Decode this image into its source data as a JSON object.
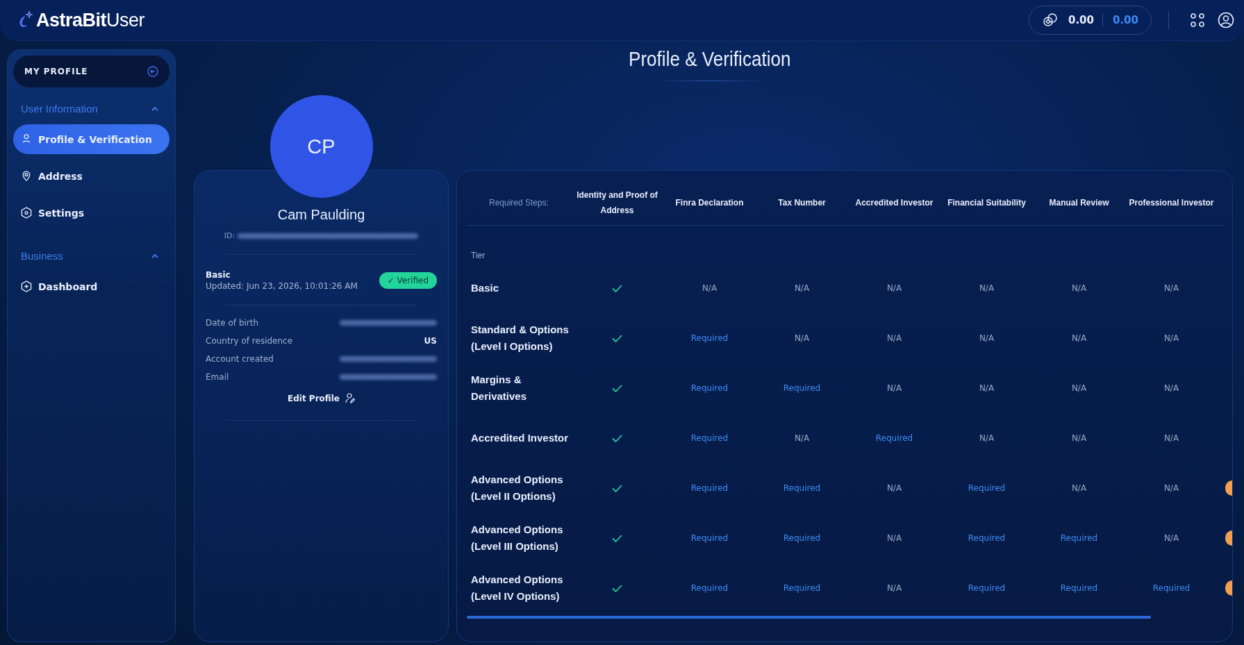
{
  "header": {
    "logo_bold": "AstraBit",
    "logo_light": "User",
    "balance_primary": "0.00",
    "balance_secondary": "0.00"
  },
  "sidebar": {
    "title": "MY PROFILE",
    "sections": [
      {
        "label": "User Information",
        "expanded": true,
        "items": [
          {
            "label": "Profile & Verification",
            "selected": true
          },
          {
            "label": "Address",
            "selected": false
          },
          {
            "label": "Settings",
            "selected": false
          }
        ]
      },
      {
        "label": "Business",
        "expanded": true,
        "items": [
          {
            "label": "Dashboard",
            "selected": false
          }
        ]
      }
    ]
  },
  "page_title": "Profile & Verification",
  "profile": {
    "initials": "CP",
    "name": "Cam Paulding",
    "id_label": "ID:",
    "tier": "Basic",
    "updated": "Updated: Jun 23, 2026, 10:01:26 AM",
    "status": "✓ Verified",
    "verified": true,
    "fields": [
      {
        "label": "Date of birth",
        "redacted": true
      },
      {
        "label": "Country of residence",
        "value": "US",
        "redacted": false
      },
      {
        "label": "Account created",
        "redacted": true
      },
      {
        "label": "Email",
        "redacted": true
      }
    ],
    "edit_button": "Edit Profile"
  },
  "table": {
    "corner": "Required Steps:",
    "columns": [
      "Identity and Proof of Address",
      "Finra Declaration",
      "Tax Number",
      "Accredited Investor",
      "Financial Suitability",
      "Manual Review",
      "Professional Investor"
    ],
    "section_label": "Tier",
    "rows": [
      {
        "tier": "Basic",
        "marker": false,
        "cells": [
          {
            "kind": "done"
          },
          {
            "kind": "na",
            "text": "N/A"
          },
          {
            "kind": "na",
            "text": "N/A"
          },
          {
            "kind": "na",
            "text": "N/A"
          },
          {
            "kind": "na",
            "text": "N/A"
          },
          {
            "kind": "na",
            "text": "N/A"
          },
          {
            "kind": "na",
            "text": "N/A"
          }
        ]
      },
      {
        "tier": "Standard & Options (Level I Options)",
        "marker": false,
        "cells": [
          {
            "kind": "done"
          },
          {
            "kind": "required",
            "text": "Required"
          },
          {
            "kind": "na",
            "text": "N/A"
          },
          {
            "kind": "na",
            "text": "N/A"
          },
          {
            "kind": "na",
            "text": "N/A"
          },
          {
            "kind": "na",
            "text": "N/A"
          },
          {
            "kind": "na",
            "text": "N/A"
          }
        ]
      },
      {
        "tier": "Margins & Derivatives",
        "marker": false,
        "cells": [
          {
            "kind": "done"
          },
          {
            "kind": "required",
            "text": "Required"
          },
          {
            "kind": "required",
            "text": "Required"
          },
          {
            "kind": "na",
            "text": "N/A"
          },
          {
            "kind": "na",
            "text": "N/A"
          },
          {
            "kind": "na",
            "text": "N/A"
          },
          {
            "kind": "na",
            "text": "N/A"
          }
        ]
      },
      {
        "tier": "Accredited Investor",
        "marker": false,
        "cells": [
          {
            "kind": "done"
          },
          {
            "kind": "required",
            "text": "Required"
          },
          {
            "kind": "na",
            "text": "N/A"
          },
          {
            "kind": "required",
            "text": "Required"
          },
          {
            "kind": "na",
            "text": "N/A"
          },
          {
            "kind": "na",
            "text": "N/A"
          },
          {
            "kind": "na",
            "text": "N/A"
          }
        ]
      },
      {
        "tier": "Advanced Options (Level II Options)",
        "marker": true,
        "cells": [
          {
            "kind": "done"
          },
          {
            "kind": "required",
            "text": "Required"
          },
          {
            "kind": "required",
            "text": "Required"
          },
          {
            "kind": "na",
            "text": "N/A"
          },
          {
            "kind": "required",
            "text": "Required"
          },
          {
            "kind": "na",
            "text": "N/A"
          },
          {
            "kind": "na",
            "text": "N/A"
          }
        ]
      },
      {
        "tier": "Advanced Options (Level III Options)",
        "marker": true,
        "cells": [
          {
            "kind": "done"
          },
          {
            "kind": "required",
            "text": "Required"
          },
          {
            "kind": "required",
            "text": "Required"
          },
          {
            "kind": "na",
            "text": "N/A"
          },
          {
            "kind": "required",
            "text": "Required"
          },
          {
            "kind": "required",
            "text": "Required"
          },
          {
            "kind": "na",
            "text": "N/A"
          }
        ]
      },
      {
        "tier": "Advanced Options (Level IV Options)",
        "marker": true,
        "cells": [
          {
            "kind": "done"
          },
          {
            "kind": "required",
            "text": "Required"
          },
          {
            "kind": "required",
            "text": "Required"
          },
          {
            "kind": "na",
            "text": "N/A"
          },
          {
            "kind": "required",
            "text": "Required"
          },
          {
            "kind": "required",
            "text": "Required"
          },
          {
            "kind": "required",
            "text": "Required"
          }
        ]
      }
    ]
  }
}
